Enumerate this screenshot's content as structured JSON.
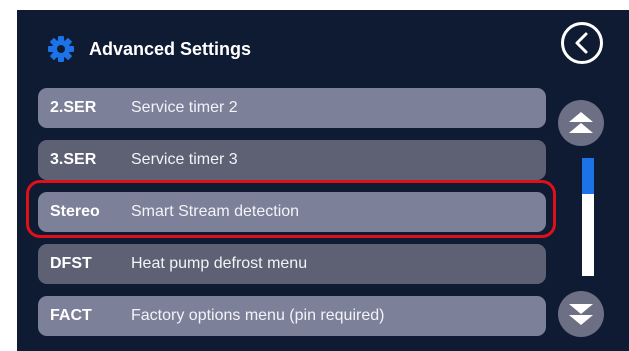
{
  "header": {
    "title": "Advanced Settings",
    "icon": "gear-icon"
  },
  "back_button": {
    "icon": "back-chevron-icon"
  },
  "menu": {
    "items": [
      {
        "code": "2.SER",
        "description": "Service timer 2"
      },
      {
        "code": "3.SER",
        "description": "Service timer 3"
      },
      {
        "code": "Stereo",
        "description": "Smart Stream detection",
        "highlighted": true
      },
      {
        "code": "DFST",
        "description": "Heat pump defrost menu"
      },
      {
        "code": "FACT",
        "description": "Factory options menu (pin required)"
      }
    ]
  },
  "scroll": {
    "up_icon": "double-chevron-up-icon",
    "down_icon": "double-chevron-down-icon",
    "position": 0.25
  },
  "colors": {
    "background": "#0f1a33",
    "row": "#7c8099",
    "row_alt": "#5e6174",
    "accent": "#1c73e8",
    "highlight": "#e01018"
  }
}
